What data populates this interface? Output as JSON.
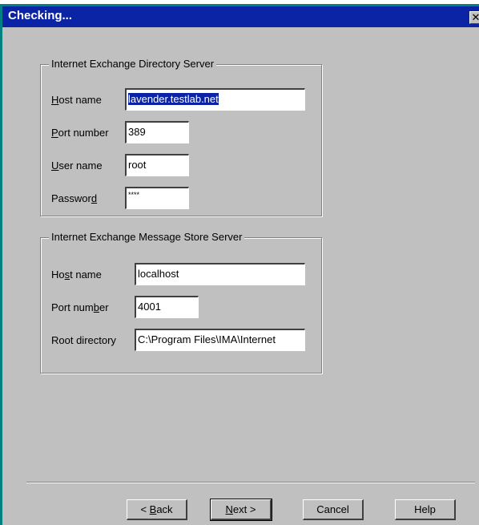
{
  "window": {
    "title": "Checking...",
    "close_glyph": "✕"
  },
  "directory_server": {
    "legend": "Internet Exchange Directory Server",
    "host_label": {
      "pre": "",
      "key": "H",
      "post": "ost name"
    },
    "host_value": "lavender.testlab.net",
    "port_label": {
      "pre": "",
      "key": "P",
      "post": "ort number"
    },
    "port_value": "389",
    "user_label": {
      "pre": "",
      "key": "U",
      "post": "ser name"
    },
    "user_value": "root",
    "password_label": {
      "pre": "Passwor",
      "key": "d",
      "post": ""
    },
    "password_value": "****"
  },
  "message_store_server": {
    "legend": "Internet Exchange Message Store Server",
    "host_label": {
      "pre": "Ho",
      "key": "s",
      "post": "t name"
    },
    "host_value": "localhost",
    "port_label": {
      "pre": "Port num",
      "key": "b",
      "post": "er"
    },
    "port_value": "4001",
    "root_label": "Root directory",
    "root_value": "C:\\Program Files\\IMA\\Internet"
  },
  "buttons": {
    "back": {
      "pre": "< ",
      "key": "B",
      "post": "ack"
    },
    "next": {
      "pre": "",
      "key": "N",
      "post": "ext >"
    },
    "cancel": "Cancel",
    "help": "Help"
  }
}
